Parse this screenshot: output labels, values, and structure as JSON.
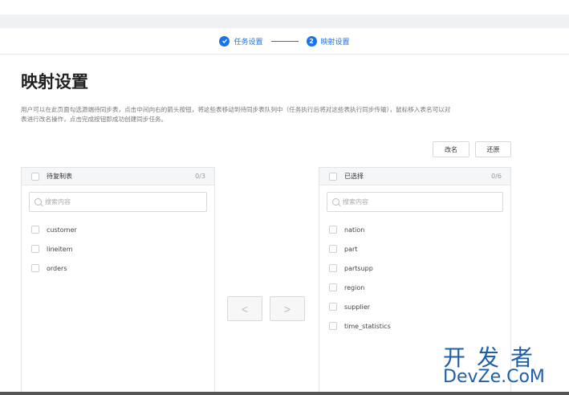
{
  "steps": [
    {
      "label": "任务设置",
      "state": "done"
    },
    {
      "label": "映射设置",
      "number": "2",
      "state": "active"
    }
  ],
  "page": {
    "title": "映射设置",
    "description": "用户可以在此页面勾选源端待同步表，点击中间向右的箭头按钮，将这些表移动到待同步表队列中（任务执行后将对这些表执行同步传输），鼠标移入表名可以对表进行改名操作，点击完成按钮即成功创建同步任务。"
  },
  "actions": {
    "rename": "改名",
    "restore": "还原"
  },
  "left_panel": {
    "title": "待复制表",
    "count": "0/3",
    "search_placeholder": "搜索内容",
    "items": [
      "customer",
      "lineitem",
      "orders"
    ]
  },
  "right_panel": {
    "title": "已选择",
    "count": "0/6",
    "search_placeholder": "搜索内容",
    "items": [
      "nation",
      "part",
      "partsupp",
      "region",
      "supplier",
      "time_statistics"
    ]
  },
  "transfer": {
    "left": "<",
    "right": ">"
  },
  "watermark": {
    "cn": "开发者",
    "en": "DevZe.CoM"
  },
  "colors": {
    "accent": "#1a73e8",
    "watermark": "#1f5fa8"
  }
}
